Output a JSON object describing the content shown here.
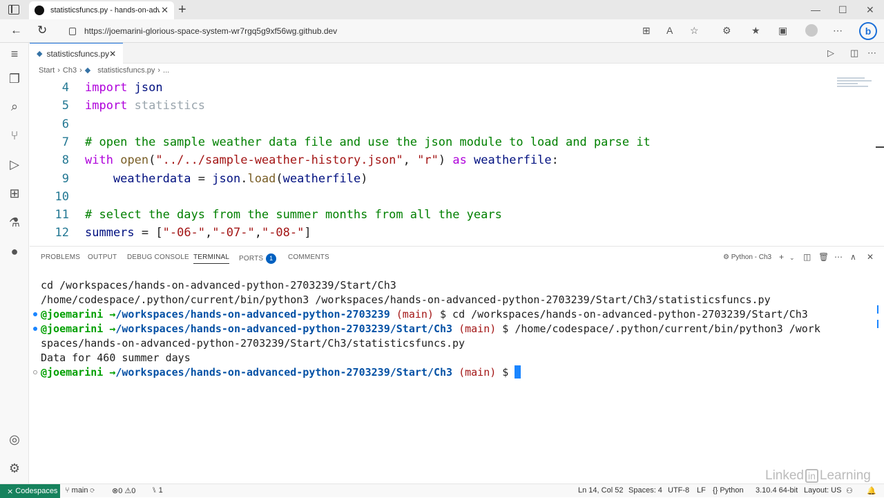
{
  "browser": {
    "tab_title": "statisticsfuncs.py - hands-on-advanced-python",
    "url": "https://joemarini-glorious-space-system-wr7rgq5g9xf56wg.github.dev"
  },
  "editor": {
    "tab_label": "statisticsfuncs.py",
    "breadcrumb": [
      "Start",
      "Ch3",
      "statisticsfuncs.py",
      "..."
    ],
    "lines": [
      {
        "n": "4",
        "tokens": [
          {
            "t": "import",
            "c": "kw"
          },
          {
            "t": " json",
            "c": "vr"
          }
        ]
      },
      {
        "n": "5",
        "tokens": [
          {
            "t": "import",
            "c": "kw"
          },
          {
            "t": " statistics",
            "c": "gray"
          }
        ]
      },
      {
        "n": "6",
        "tokens": []
      },
      {
        "n": "7",
        "tokens": [
          {
            "t": "# open the sample weather data file and use the json module to load and parse it",
            "c": "cm"
          }
        ]
      },
      {
        "n": "8",
        "tokens": [
          {
            "t": "with",
            "c": "kw"
          },
          {
            "t": " ",
            "c": ""
          },
          {
            "t": "open",
            "c": "fn"
          },
          {
            "t": "(",
            "c": ""
          },
          {
            "t": "\"../../sample-weather-history.json\"",
            "c": "st"
          },
          {
            "t": ", ",
            "c": ""
          },
          {
            "t": "\"r\"",
            "c": "st"
          },
          {
            "t": ") ",
            "c": ""
          },
          {
            "t": "as",
            "c": "kw"
          },
          {
            "t": " weatherfile",
            "c": "vr"
          },
          {
            "t": ":",
            "c": ""
          }
        ]
      },
      {
        "n": "9",
        "tokens": [
          {
            "t": "    weatherdata",
            "c": "vr"
          },
          {
            "t": " = ",
            "c": ""
          },
          {
            "t": "json",
            "c": "vr"
          },
          {
            "t": ".",
            "c": ""
          },
          {
            "t": "load",
            "c": "fn"
          },
          {
            "t": "(",
            "c": ""
          },
          {
            "t": "weatherfile",
            "c": "vr"
          },
          {
            "t": ")",
            "c": ""
          }
        ]
      },
      {
        "n": "10",
        "tokens": []
      },
      {
        "n": "11",
        "tokens": [
          {
            "t": "# select the days from the summer months from all the years",
            "c": "cm"
          }
        ]
      },
      {
        "n": "12",
        "tokens": [
          {
            "t": "summers",
            "c": "vr"
          },
          {
            "t": " = [",
            "c": ""
          },
          {
            "t": "\"-06-\"",
            "c": "st"
          },
          {
            "t": ",",
            "c": ""
          },
          {
            "t": "\"-07-\"",
            "c": "st"
          },
          {
            "t": ",",
            "c": ""
          },
          {
            "t": "\"-08-\"",
            "c": "st"
          },
          {
            "t": "]",
            "c": ""
          }
        ]
      }
    ]
  },
  "panel": {
    "tabs": [
      "PROBLEMS",
      "OUTPUT",
      "DEBUG CONSOLE",
      "TERMINAL",
      "PORTS",
      "COMMENTS"
    ],
    "ports_count": "1",
    "terminal_name": "Python - Ch3",
    "terminal": {
      "l1": "cd /workspaces/hands-on-advanced-python-2703239/Start/Ch3",
      "l2": "/home/codespace/.python/current/bin/python3 /workspaces/hands-on-advanced-python-2703239/Start/Ch3/statisticsfuncs.py",
      "user": "@joemarini",
      "arrow": " →",
      "path1": "/workspaces/hands-on-advanced-python-2703239",
      "branch": "(main)",
      "cmd1": " $ cd /workspaces/hands-on-advanced-python-2703239/Start/Ch3",
      "path2": "/workspaces/hands-on-advanced-python-2703239/Start/Ch3",
      "cmd2": " $ /home/codespace/.python/current/bin/python3 /work",
      "l4b": "spaces/hands-on-advanced-python-2703239/Start/Ch3/statisticsfuncs.py",
      "output": "Data for 460 summer days",
      "prompt_end": " $ "
    }
  },
  "status": {
    "remote": "Codespaces",
    "branch": "main",
    "errors": "0",
    "warnings": "0",
    "ports": "1",
    "position": "Ln 14, Col 52",
    "spaces": "Spaces: 4",
    "encoding": "UTF-8",
    "eol": "LF",
    "language": "Python",
    "interpreter": "3.10.4 64-bit",
    "layout": "Layout: US"
  },
  "watermark": "Linked in Learning"
}
